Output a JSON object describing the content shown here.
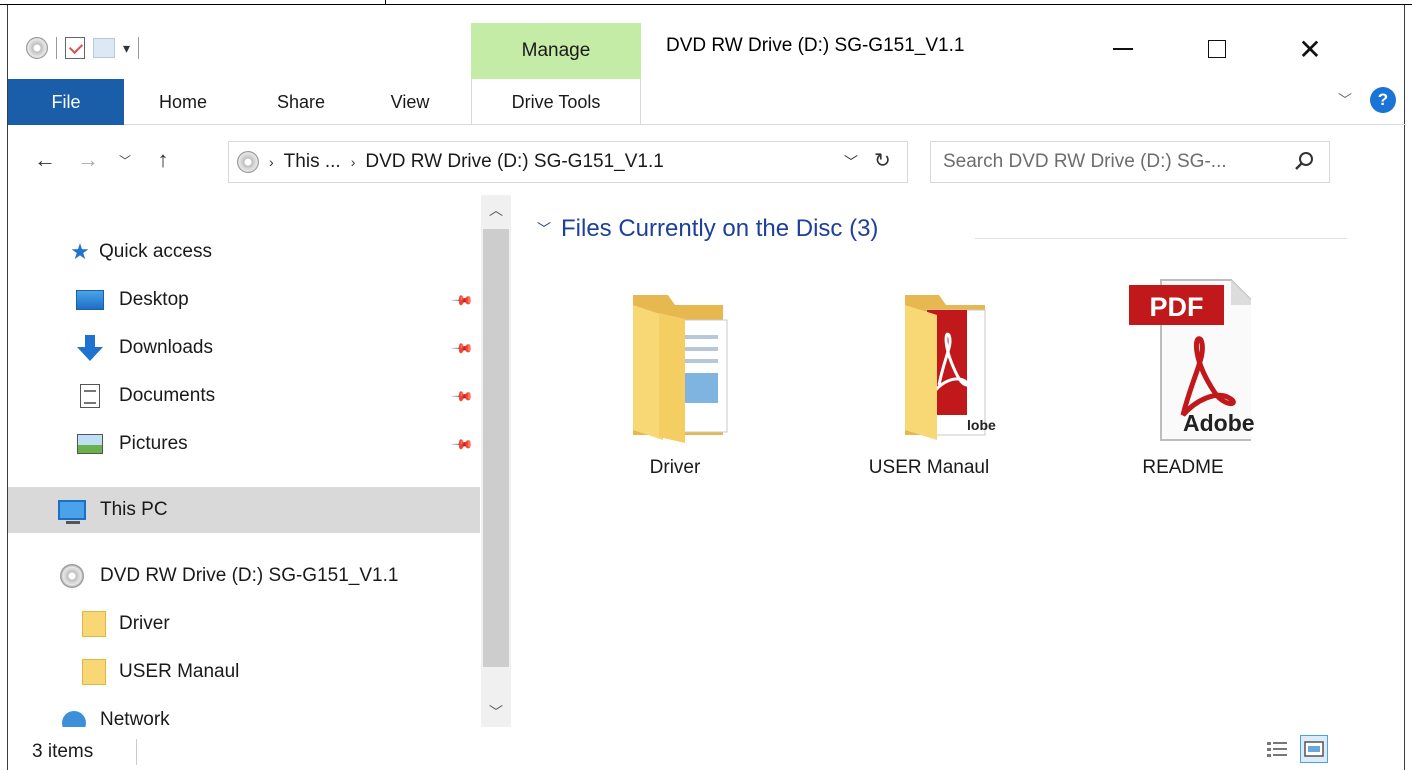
{
  "window": {
    "title": "DVD RW Drive (D:) SG-G151_V1.1",
    "contextual_group": "Manage"
  },
  "ribbon": {
    "tabs": [
      "File",
      "Home",
      "Share",
      "View",
      "Drive Tools"
    ]
  },
  "address": {
    "crumbs": [
      "This ...",
      "DVD RW Drive (D:) SG-G151_V1.1"
    ],
    "search_placeholder": "Search DVD RW Drive (D:) SG-..."
  },
  "sidebar": {
    "quick_access": "Quick access",
    "items": [
      {
        "label": "Desktop",
        "icon": "desktop-icon",
        "pinned": true
      },
      {
        "label": "Downloads",
        "icon": "downloads-icon",
        "pinned": true
      },
      {
        "label": "Documents",
        "icon": "documents-icon",
        "pinned": true
      },
      {
        "label": "Pictures",
        "icon": "pictures-icon",
        "pinned": true
      }
    ],
    "this_pc": "This PC",
    "drive": "DVD RW Drive (D:) SG-G151_V1.1",
    "drive_children": [
      "Driver",
      "USER Manaul"
    ],
    "network_partial": "Network"
  },
  "main": {
    "group_title": "Files Currently on the Disc (3)",
    "files": [
      {
        "name": "Driver",
        "type": "folder"
      },
      {
        "name": "USER Manaul",
        "type": "folder-pdf"
      },
      {
        "name": "README",
        "type": "pdf"
      }
    ],
    "pdf_badge": "PDF",
    "adobe_text": "Adobe"
  },
  "status": {
    "item_count": "3 items"
  },
  "colors": {
    "file_tab": "#1a5ea9",
    "manage_tab": "#c5eca7",
    "group_header": "#1e3f9a",
    "selection": "#d9d9d9"
  }
}
